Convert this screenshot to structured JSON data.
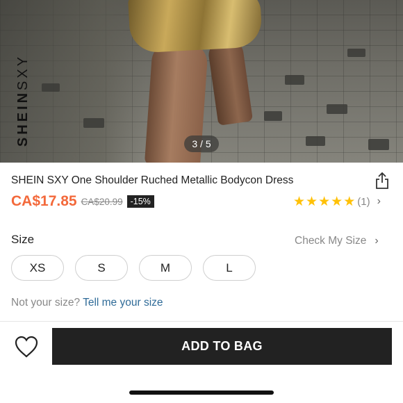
{
  "gallery": {
    "brand_logo_bold": "SHEIN",
    "brand_logo_light": "SXY",
    "pager": "3 / 5"
  },
  "product": {
    "title": "SHEIN SXY One Shoulder Ruched Metallic Bodycon Dress",
    "price": "CA$17.85",
    "original_price": "CA$20.99",
    "discount": "-15%",
    "rating_stars": 5,
    "rating_count": "(1)",
    "price_color": "#f3693b",
    "star_color": "#ffc107"
  },
  "size_section": {
    "label": "Size",
    "check_my_size": "Check My Size",
    "options": [
      "XS",
      "S",
      "M",
      "L"
    ],
    "not_your_size": "Not your size?",
    "tell_me_link": "Tell me your size",
    "link_color": "#2f6b98"
  },
  "actions": {
    "add_to_bag": "ADD TO BAG",
    "wishlist_icon": "heart-icon",
    "share_icon": "share-icon"
  }
}
